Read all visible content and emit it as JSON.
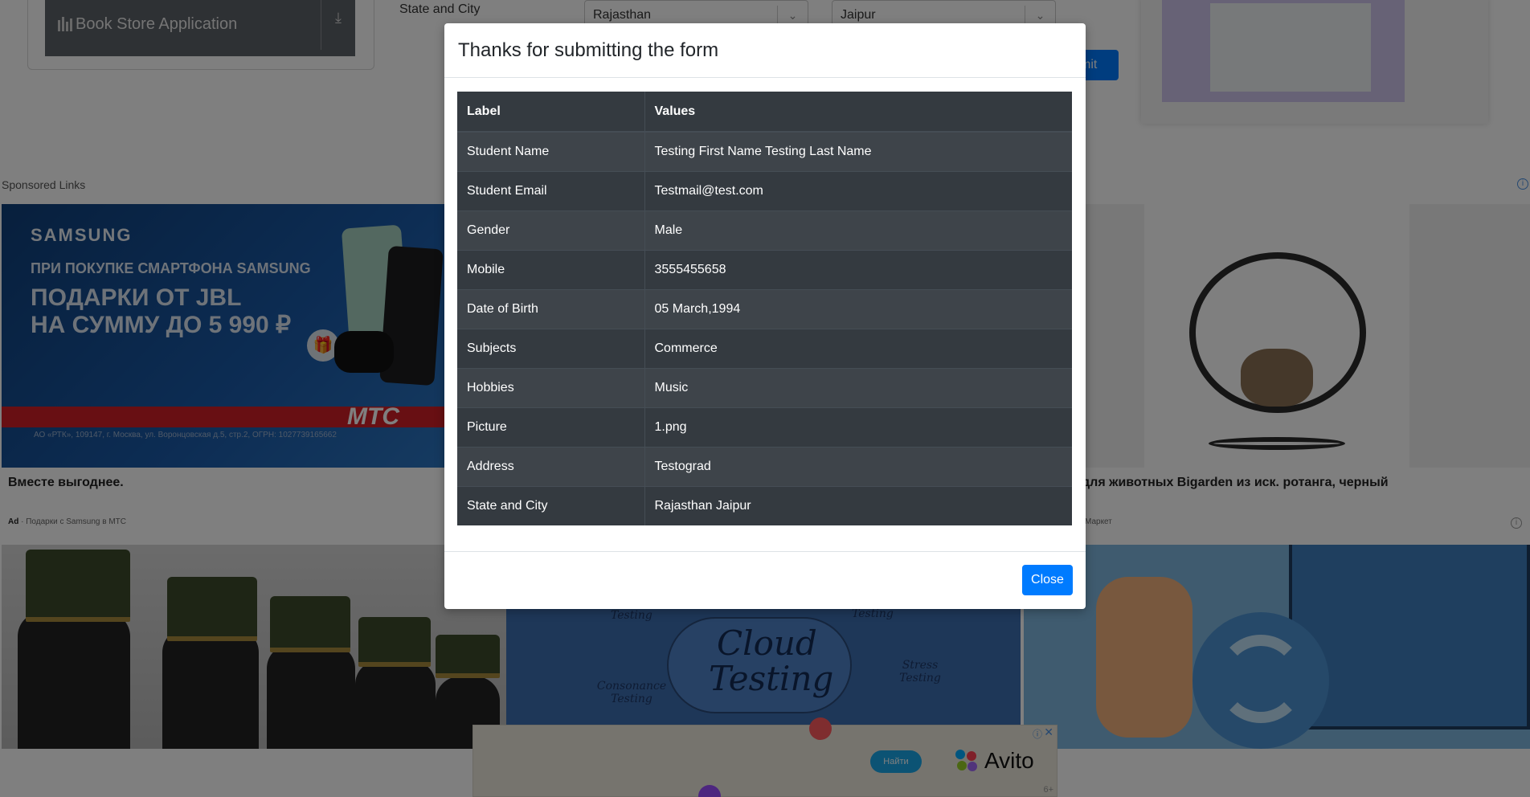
{
  "background": {
    "sidebar": {
      "book_store_label": "Book Store Application"
    },
    "form": {
      "state_city_label": "State and City",
      "state_value": "Rajasthan",
      "city_value": "Jaipur",
      "submit_fragment": "mit"
    },
    "ads": {
      "sponsored_label": "Sponsored Links",
      "samsung": {
        "brand": "SAMSUNG",
        "line1": "ПРИ ПОКУПКЕ СМАРТФОНА SAMSUNG",
        "line2a": "ПОДАРКИ ОТ JBL",
        "line2b": "НА СУММУ ДО 5 990 ₽",
        "mts": "МТС",
        "fine_print": "АО «РТК», 109147, г. Москва, ул. Воронцовская д.5, стр.2, ОГРН: 1027739165662",
        "caption": "Вместе выгоднее.",
        "ad_badge": "Ad",
        "ad_source": "Подарки с Samsung в МТС"
      },
      "cat": {
        "caption": "для животных Bigarden из иск. ротанга, черный",
        "source": "Маркет"
      },
      "cloud": {
        "title_line1": "Cloud",
        "title_line2": "Testing",
        "tag_a": "Testing",
        "tag_b": "Testing",
        "tag_c": "Consonance Testing",
        "tag_d": "Stress Testing"
      },
      "avito": {
        "button": "Найти",
        "logo": "Avito",
        "age": "6+"
      }
    }
  },
  "modal": {
    "title": "Thanks for submitting the form",
    "table": {
      "headers": [
        "Label",
        "Values"
      ],
      "rows": [
        {
          "label": "Student Name",
          "value": "Testing First Name Testing Last Name"
        },
        {
          "label": "Student Email",
          "value": "Testmail@test.com"
        },
        {
          "label": "Gender",
          "value": "Male"
        },
        {
          "label": "Mobile",
          "value": "3555455658"
        },
        {
          "label": "Date of Birth",
          "value": "05 March,1994"
        },
        {
          "label": "Subjects",
          "value": "Commerce"
        },
        {
          "label": "Hobbies",
          "value": "Music"
        },
        {
          "label": "Picture",
          "value": "1.png"
        },
        {
          "label": "Address",
          "value": "Testograd"
        },
        {
          "label": "State and City",
          "value": "Rajasthan Jaipur"
        }
      ]
    },
    "close_label": "Close"
  },
  "colors": {
    "primary": "#007bff",
    "table_dark": "#343a40",
    "overlay": "rgba(0,0,0,0.5)"
  }
}
